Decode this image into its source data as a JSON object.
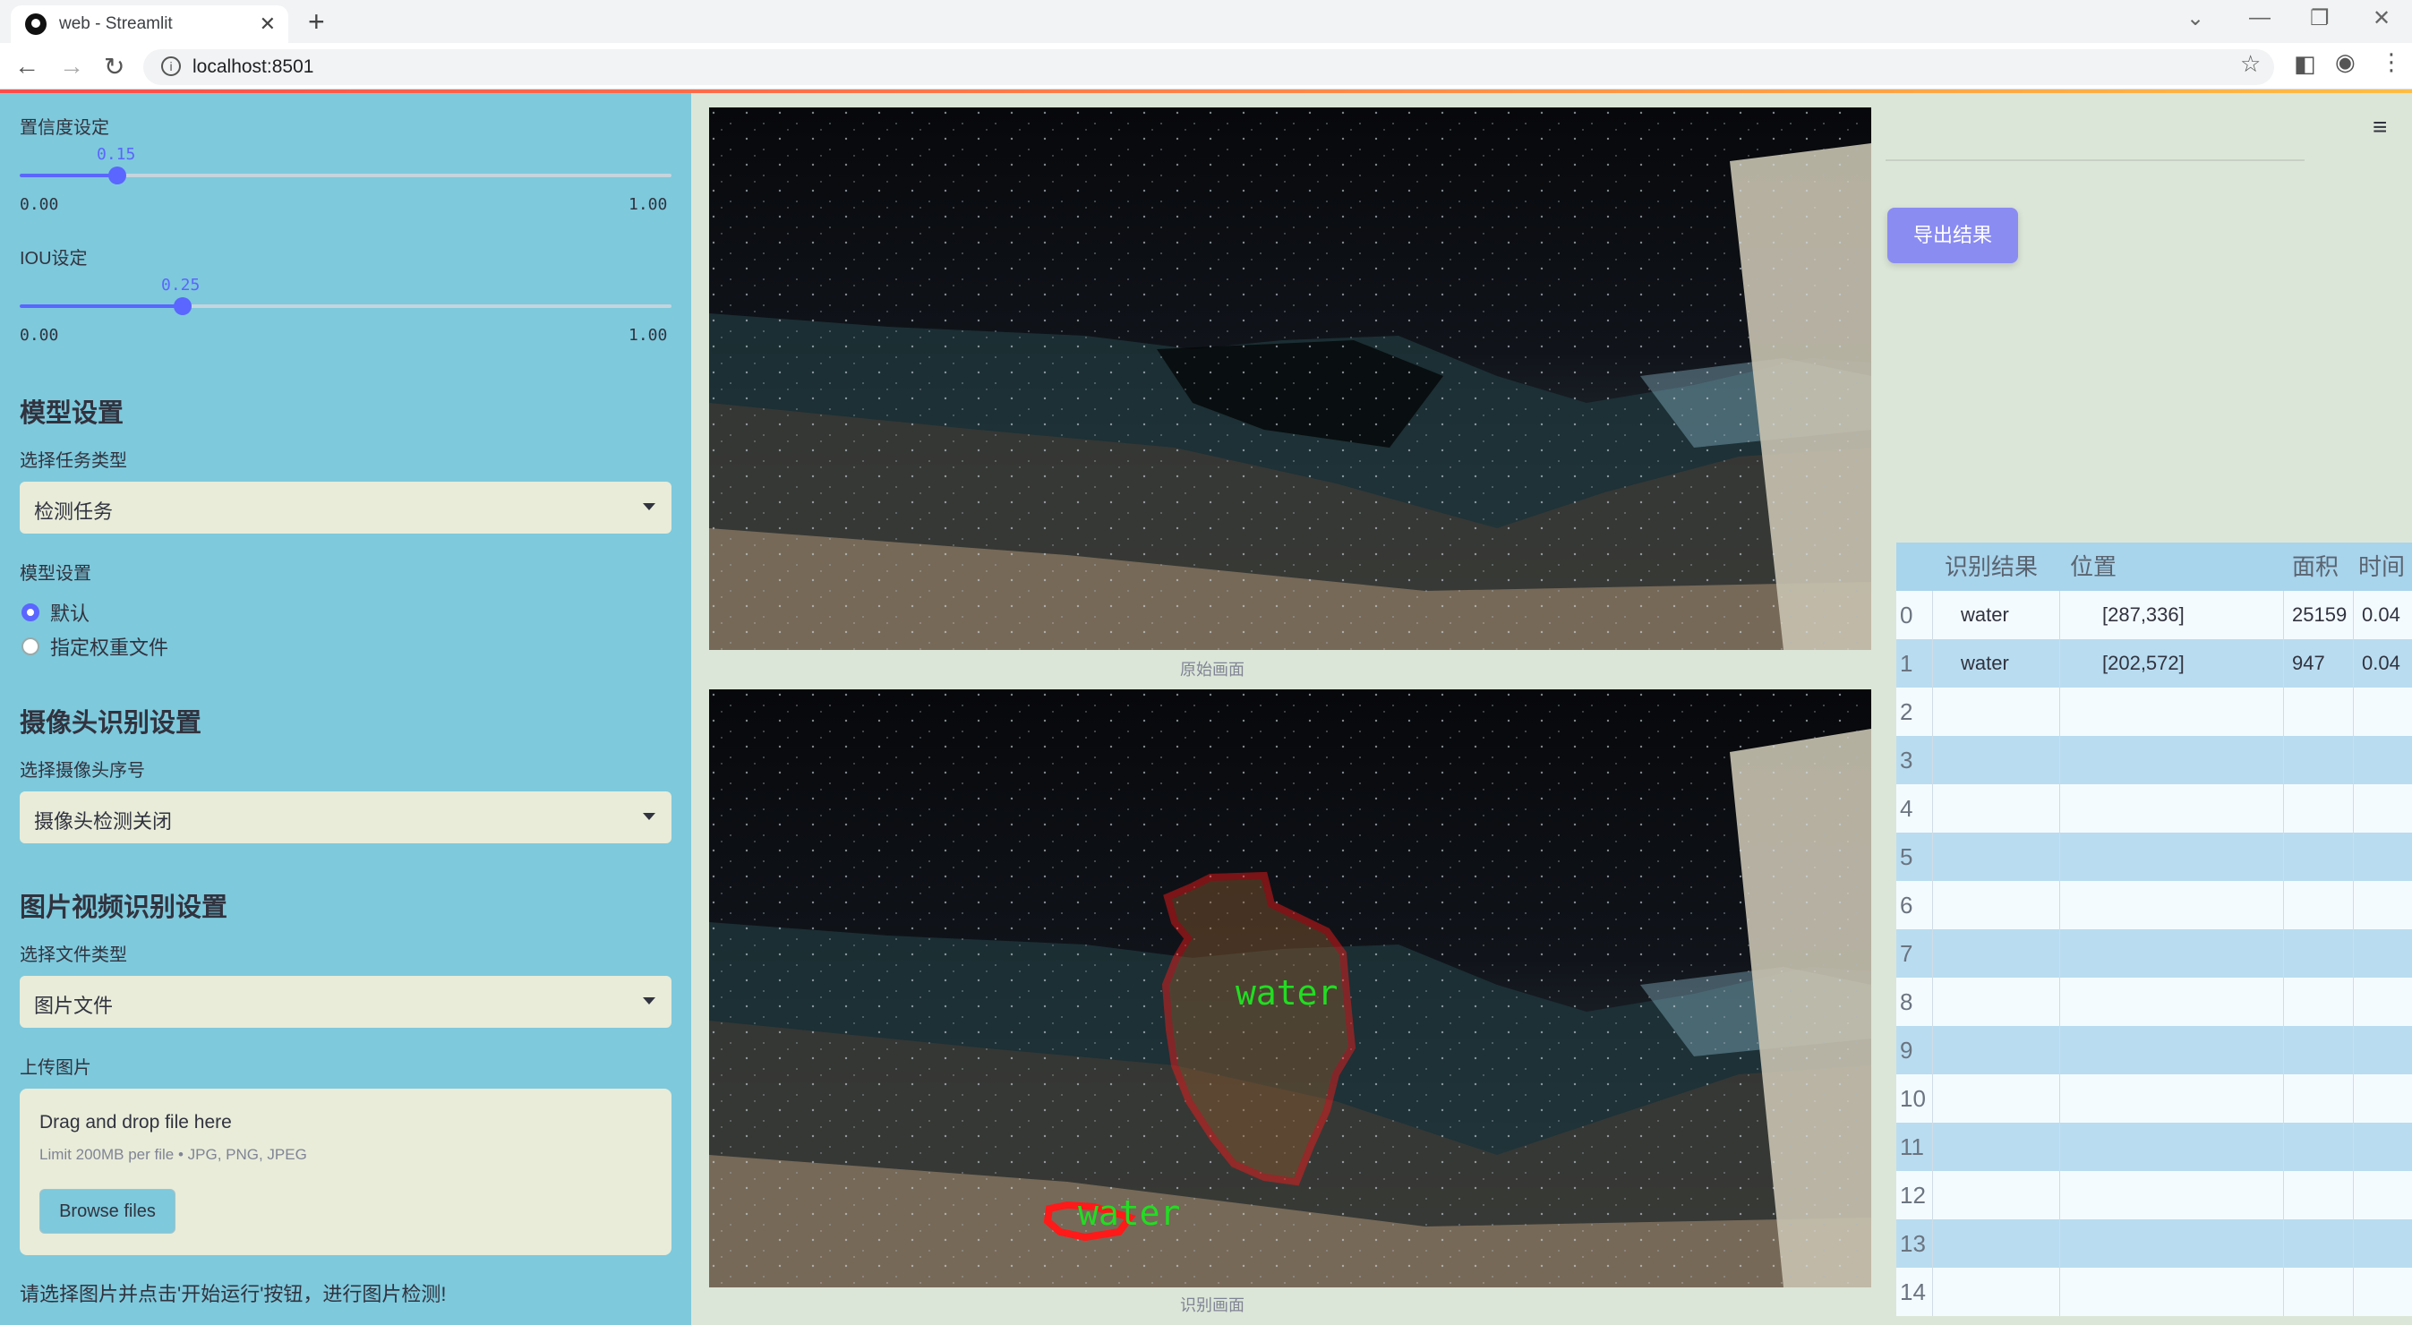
{
  "browser": {
    "tab_title": "web - Streamlit",
    "url": "localhost:8501",
    "new_tab": "+",
    "close_tab": "✕"
  },
  "sidebar": {
    "confidence": {
      "label": "置信度设定",
      "value": "0.15",
      "level": 0.15,
      "min": "0.00",
      "max": "1.00"
    },
    "iou": {
      "label": "IOU设定",
      "value": "0.25",
      "level": 0.25,
      "min": "0.00",
      "max": "1.00"
    },
    "model_section": {
      "heading": "模型设置",
      "task_label": "选择任务类型",
      "task_value": "检测任务",
      "model_label": "模型设置",
      "options": [
        "默认",
        "指定权重文件"
      ],
      "selected": 0
    },
    "camera_section": {
      "heading": "摄像头识别设置",
      "camera_label": "选择摄像头序号",
      "camera_value": "摄像头检测关闭"
    },
    "media_section": {
      "heading": "图片视频识别设置",
      "file_type_label": "选择文件类型",
      "file_type_value": "图片文件",
      "upload_label": "上传图片",
      "dropzone_title": "Drag and drop file here",
      "dropzone_limit": "Limit 200MB per file • JPG, PNG, JPEG",
      "browse_button": "Browse files"
    },
    "hint": "请选择图片并点击'开始运行'按钮，进行图片检测!"
  },
  "main": {
    "original_caption": "原始画面",
    "result_caption": "识别画面",
    "detection_labels": [
      "water",
      "water"
    ],
    "export_button": "导出结果",
    "colors": {
      "accent": "#5a66ff",
      "sidebar": "#7ec9dc",
      "detection": "#ff1a1a",
      "label": "#22dd22"
    }
  },
  "results_table": {
    "columns": [
      "识别结果",
      "位置",
      "面积",
      "时间"
    ],
    "rows": [
      {
        "idx": "0",
        "result": "water",
        "position": "[287,336]",
        "area": "25159",
        "time": "0.04"
      },
      {
        "idx": "1",
        "result": "water",
        "position": "[202,572]",
        "area": "947",
        "time": "0.04"
      },
      {
        "idx": "2",
        "result": "",
        "position": "",
        "area": "",
        "time": ""
      },
      {
        "idx": "3",
        "result": "",
        "position": "",
        "area": "",
        "time": ""
      },
      {
        "idx": "4",
        "result": "",
        "position": "",
        "area": "",
        "time": ""
      },
      {
        "idx": "5",
        "result": "",
        "position": "",
        "area": "",
        "time": ""
      },
      {
        "idx": "6",
        "result": "",
        "position": "",
        "area": "",
        "time": ""
      },
      {
        "idx": "7",
        "result": "",
        "position": "",
        "area": "",
        "time": ""
      },
      {
        "idx": "8",
        "result": "",
        "position": "",
        "area": "",
        "time": ""
      },
      {
        "idx": "9",
        "result": "",
        "position": "",
        "area": "",
        "time": ""
      },
      {
        "idx": "10",
        "result": "",
        "position": "",
        "area": "",
        "time": ""
      },
      {
        "idx": "11",
        "result": "",
        "position": "",
        "area": "",
        "time": ""
      },
      {
        "idx": "12",
        "result": "",
        "position": "",
        "area": "",
        "time": ""
      },
      {
        "idx": "13",
        "result": "",
        "position": "",
        "area": "",
        "time": ""
      },
      {
        "idx": "14",
        "result": "",
        "position": "",
        "area": "",
        "time": ""
      }
    ]
  }
}
